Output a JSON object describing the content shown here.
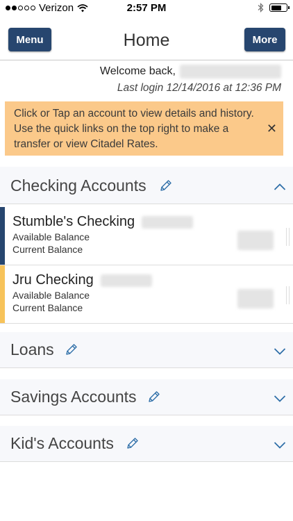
{
  "status_bar": {
    "carrier": "Verizon",
    "time": "2:57 PM",
    "signal_bars": 2,
    "battery_level": 0.7
  },
  "nav": {
    "menu_label": "Menu",
    "title": "Home",
    "more_label": "More"
  },
  "welcome": {
    "greeting": "Welcome back,",
    "last_login": "Last login 12/14/2016 at 12:36 PM"
  },
  "banner": {
    "message": "Click or Tap an account to view details and history. Use the quick links on the top right to make a transfer or view Citadel Rates.",
    "close_symbol": "✕"
  },
  "sections": [
    {
      "title": "Checking Accounts",
      "expanded": true,
      "accounts": [
        {
          "name": "Stumble's Checking",
          "available_label": "Available Balance",
          "current_label": "Current Balance",
          "accent": "#27466f"
        },
        {
          "name": "Jru Checking",
          "available_label": "Available Balance",
          "current_label": "Current Balance",
          "accent": "#f7c35a"
        }
      ]
    },
    {
      "title": "Loans",
      "expanded": false
    },
    {
      "title": "Savings Accounts",
      "expanded": false
    },
    {
      "title": "Kid's Accounts",
      "expanded": false
    }
  ],
  "colors": {
    "nav_button": "#27466f",
    "banner": "#fbc98a",
    "link_blue": "#2f6fa8",
    "section_bg": "#f7f8fb"
  }
}
